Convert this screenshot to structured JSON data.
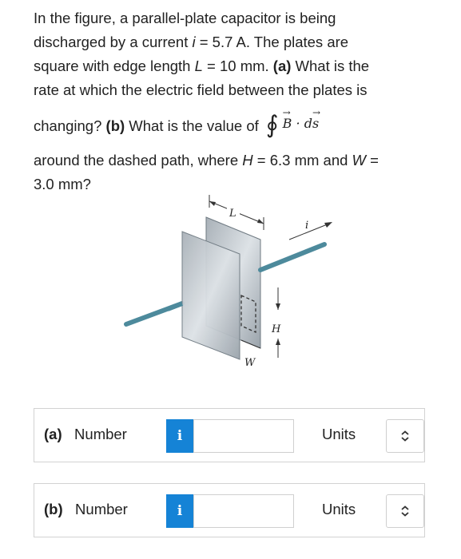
{
  "question": {
    "line1": "In the figure, a parallel-plate capacitor is being",
    "line2_a": "discharged by a current ",
    "line2_i": "i",
    "line2_b": " = 5.7 A. The plates are",
    "line3_a": "square with edge length ",
    "line3_L": "L",
    "line3_b": " = 10 mm. ",
    "line3_part": "(a)",
    "line3_c": " What is the",
    "line4": "rate at which the electric field between the plates is",
    "line5_a": "changing? ",
    "line5_part": "(b)",
    "line5_b": " What is the value of",
    "integral_B": "B",
    "integral_dot": "·",
    "integral_d": "d",
    "integral_s": "s",
    "line6_a": "around the dashed path, where ",
    "line6_H": "H",
    "line6_b": " = 6.3 mm and ",
    "line6_W": "W",
    "line6_c": " =",
    "line7": "3.0 mm?"
  },
  "figure": {
    "label_L": "L",
    "label_i": "i",
    "label_H": "H",
    "label_W": "W"
  },
  "answers": [
    {
      "part": "(a)",
      "label": "Number",
      "info": "i",
      "value": "",
      "units_label": "Units",
      "units_value": ""
    },
    {
      "part": "(b)",
      "label": "Number",
      "info": "i",
      "value": "",
      "units_label": "Units",
      "units_value": ""
    }
  ],
  "colors": {
    "info_button": "#1583d6",
    "wire": "#6aa3b3",
    "plate": "#b9c1c8"
  },
  "icons": {
    "info": "info-icon",
    "select": "chevron-updown-icon"
  }
}
